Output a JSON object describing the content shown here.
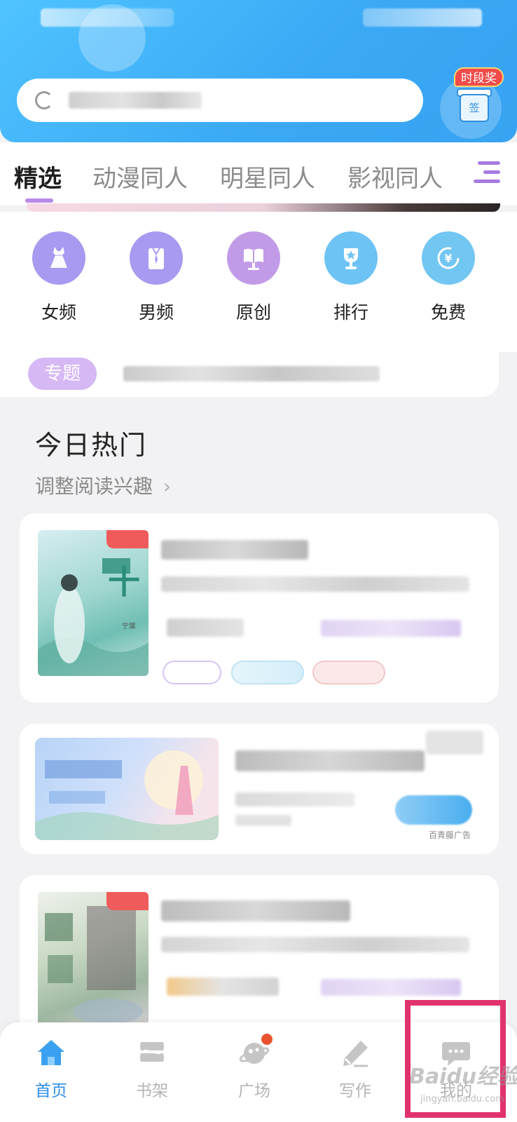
{
  "header": {
    "search_placeholder": "",
    "checkin_reward": "时段奖",
    "checkin_label": "签"
  },
  "tabs": [
    {
      "label": "精选",
      "active": true
    },
    {
      "label": "动漫同人",
      "active": false
    },
    {
      "label": "明星同人",
      "active": false
    },
    {
      "label": "影视同人",
      "active": false
    }
  ],
  "categories": [
    {
      "label": "女频",
      "icon": "dress-icon",
      "color": "#a89af0"
    },
    {
      "label": "男频",
      "icon": "shirt-icon",
      "color": "#a89af0"
    },
    {
      "label": "原创",
      "icon": "book-stand-icon",
      "color": "#c29be8"
    },
    {
      "label": "排行",
      "icon": "trophy-icon",
      "color": "#6ec3f5"
    },
    {
      "label": "免费",
      "icon": "yuan-coin-icon",
      "color": "#72c6f2"
    }
  ],
  "topic": {
    "badge": "专题"
  },
  "hot_section": {
    "title": "今日热门",
    "interest_link": "调整阅读兴趣",
    "cover_text": "宁棠"
  },
  "ad": {
    "source_label": "百青藤广告"
  },
  "bottom_nav": [
    {
      "label": "首页",
      "icon": "home-icon",
      "active": true
    },
    {
      "label": "书架",
      "icon": "bookshelf-icon",
      "active": false
    },
    {
      "label": "广场",
      "icon": "planet-icon",
      "active": false,
      "badge": true
    },
    {
      "label": "写作",
      "icon": "pen-icon",
      "active": false
    },
    {
      "label": "我的",
      "icon": "chat-bubble-icon",
      "active": false
    }
  ],
  "watermark": {
    "text": "Baidu经验",
    "sub": "jingyan.baidu.com"
  },
  "colors": {
    "primary_blue": "#3aa8f5",
    "accent_purple": "#b88ae8",
    "highlight_red": "#e0336e"
  }
}
